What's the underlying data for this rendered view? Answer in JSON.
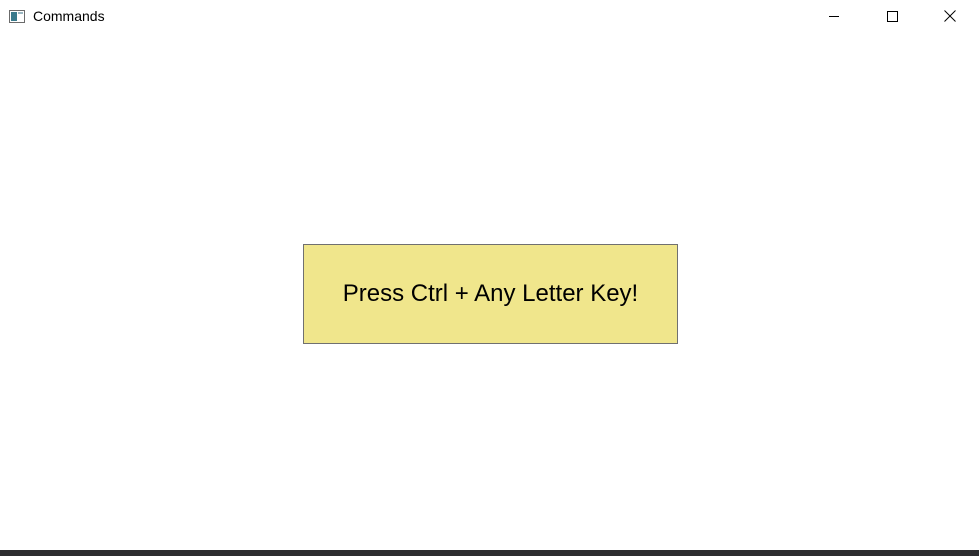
{
  "window": {
    "title": "Commands",
    "icons": {
      "app": "window-app-icon",
      "minimize": "minimize-icon",
      "maximize": "maximize-icon",
      "close": "close-icon"
    }
  },
  "main": {
    "button_label": "Press Ctrl + Any Letter Key!",
    "button_color": "#f0e68c"
  }
}
